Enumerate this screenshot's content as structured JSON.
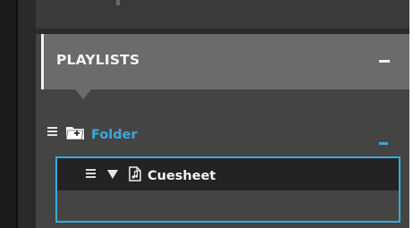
{
  "playlists_panel": {
    "header_title": "PLAYLISTS",
    "header_collapse_glyph": "–",
    "folder": {
      "label": "Folder",
      "icon": "folder-add-icon",
      "collapse_glyph": "–"
    },
    "cuesheet": {
      "label": "Cuesheet",
      "icon": "music-document-icon",
      "expand_state": "expanded"
    }
  },
  "colors": {
    "accent_blue": "#3aa9e0",
    "selection_border": "#2fb0dc",
    "header_bg": "#6b6b6b",
    "panel_bg": "#444444",
    "row_selected_bg": "#232323"
  }
}
